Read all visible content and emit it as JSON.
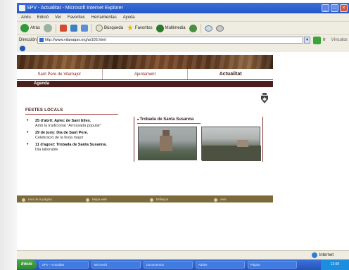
{
  "window": {
    "title": "SPV - Actualitat - Microsoft Internet Explorer",
    "controls": [
      "_",
      "□",
      "×"
    ]
  },
  "menu": {
    "items": [
      "Arxiu",
      "Edició",
      "Ver",
      "Favorites",
      "Herramientas",
      "Ayuda"
    ]
  },
  "toolbar": {
    "back_label": "Atrás",
    "search_label": "Búsqueda",
    "favorites_label": "Favoritos",
    "multimedia_label": "Multimedia"
  },
  "address": {
    "label": "Dirección",
    "url": "http://www.vilanagav.org/ar105.html",
    "go_label": "Ir",
    "links_label": "Vínculos"
  },
  "site": {
    "nav": [
      {
        "label": "Sant Pere de Vilamajor"
      },
      {
        "label": "Ajuntament"
      },
      {
        "label": "Actualitat"
      }
    ],
    "agenda_label": "Agenda",
    "section_title": "FESTES LOCALS",
    "events": [
      {
        "title": "25 d'abril: Aplec de Sant Elies.",
        "sub": "Amb la tradicional \"Arrossada popular\""
      },
      {
        "title": "29 de juny: Dia de Sant Pere.",
        "sub": "Celebració de la festa major"
      },
      {
        "title": "11 d'agost: Trobada de Santa Susanna.",
        "sub": "Dia laborable"
      }
    ],
    "photo_panel_title": "Trobada de Santa Susanna",
    "footer_items": [
      "Inici de la pàgina",
      "Mapa web",
      "Enllaços",
      "Avís"
    ]
  },
  "status": {
    "zone_label": "Internet"
  },
  "taskbar": {
    "start_label": "Inicio",
    "items": [
      "SPV - Actualitat",
      "Microsoft",
      "Documentos",
      "Adobe",
      "Página"
    ],
    "tray_text": "12:00"
  },
  "colors": {
    "accent_red": "#8e1b1b",
    "agenda_bar": "#4a1f1d",
    "footer_bar": "#7d6a3a",
    "titlebar_blue": "#2456c8"
  }
}
